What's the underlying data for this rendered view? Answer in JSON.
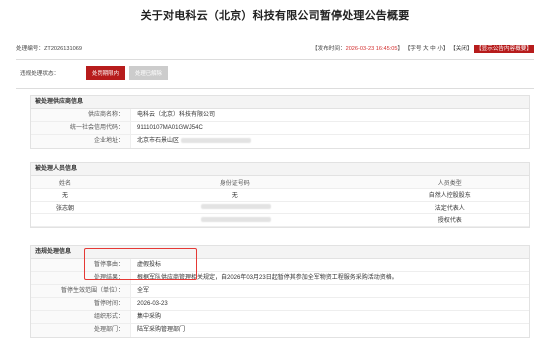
{
  "title": "关于对电科云（北京）科技有限公司暂停处理公告概要",
  "meta": {
    "number_label": "处理编号：",
    "number": "ZT2026131069",
    "date_label": "【发布时间：",
    "date_value": "2026-03-23 16:45:05",
    "date_close": "】",
    "font_size": "【字号 大 中 小】",
    "close": "【关闭】",
    "show_content": "【显示公告内容概要】"
  },
  "status": {
    "label": "违规处理状态：",
    "active": "处罚期限内",
    "inactive": "处理已解除"
  },
  "supplier": {
    "heading": "被处理供应商信息",
    "rows": [
      {
        "k": "供应商名称：",
        "v": "电科云（北京）科技有限公司"
      },
      {
        "k": "统一社会信用代码：",
        "v": "91110107MA01GWJ54C"
      },
      {
        "k": "企业地址：",
        "v": "北京市石景山区"
      }
    ]
  },
  "persons": {
    "heading": "被处理人员信息",
    "headers": [
      "姓名",
      "身份证号码",
      "人员类型"
    ],
    "rows": [
      [
        "无",
        "无",
        "自然人控股股东"
      ],
      [
        "张志朝",
        "",
        "法定代表人"
      ],
      [
        "",
        "",
        "授权代表"
      ]
    ]
  },
  "violation": {
    "heading": "违规处理信息",
    "rows": [
      {
        "k": "暂停事由：",
        "v": "虚假投标"
      },
      {
        "k": "处理结果：",
        "v": "根据军队供应商管理相关规定，自2026年03月23日起暂停其参加全军物资工程服务采购活动资格。"
      },
      {
        "k": "暂停生效范围（单位）：",
        "v": "全军"
      },
      {
        "k": "暂停时间：",
        "v": "2026-03-23"
      },
      {
        "k": "组织形式：",
        "v": "集中采购"
      },
      {
        "k": "处理部门：",
        "v": "陆军采购管理部门"
      }
    ]
  }
}
